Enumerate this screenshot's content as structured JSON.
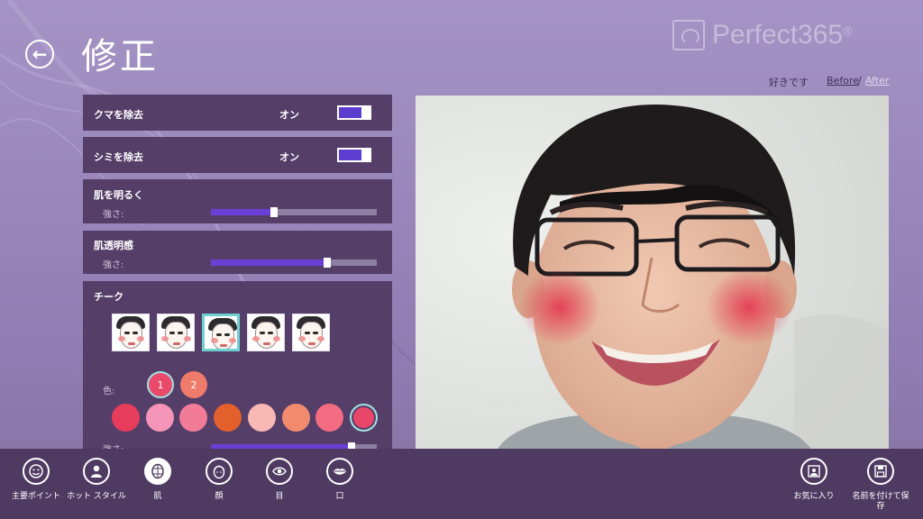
{
  "header": {
    "back_icon": "arrow-left-icon",
    "title": "修正",
    "logo_text": "Perfect365",
    "logo_mark": "®"
  },
  "view": {
    "favorite": "好きです",
    "before": "Before",
    "separator": "/",
    "after": "After"
  },
  "panels": {
    "dark_circles": {
      "label": "クマを除去",
      "state": "オン",
      "on": true
    },
    "spots": {
      "label": "シミを除去",
      "state": "オン",
      "on": true
    },
    "brighten": {
      "label": "肌を明るく",
      "strength_label": "強さ:",
      "value": 0.38
    },
    "clarity": {
      "label": "肌透明感",
      "strength_label": "強さ:",
      "value": 0.7
    },
    "cheek": {
      "label": "チーク",
      "styles": [
        "cheek-style-1",
        "cheek-style-2",
        "cheek-style-3",
        "cheek-style-4",
        "cheek-style-5"
      ],
      "selected_style": 2,
      "color_label": "色:",
      "color_slots": [
        {
          "label": "1",
          "color": "#ea4a6a",
          "selected": true
        },
        {
          "label": "2",
          "color": "#ef7b6b",
          "selected": false
        }
      ],
      "palette": [
        "#e83c5c",
        "#f596b8",
        "#f27c98",
        "#e3602c",
        "#f8b8b4",
        "#f28b6e",
        "#f46c82",
        "#e8476a"
      ],
      "selected_color": 7,
      "strength_label": "強さ:",
      "strength": 0.85
    }
  },
  "toolbar": {
    "items": [
      {
        "label": "主要ポイント",
        "icon": "smiley-icon"
      },
      {
        "label": "ホット スタイル",
        "icon": "person-icon"
      },
      {
        "label": "肌",
        "icon": "skin-icon",
        "active": true
      },
      {
        "label": "顔",
        "icon": "face-icon"
      },
      {
        "label": "目",
        "icon": "eye-icon"
      },
      {
        "label": "口",
        "icon": "lips-icon"
      }
    ],
    "favorites": {
      "label": "お気に入り",
      "icon": "favorites-icon"
    },
    "save_as": {
      "label": "名前を付けて保存",
      "label_line1": "名前を付けて保",
      "label_line2": "存",
      "icon": "save-icon"
    }
  },
  "colors": {
    "accent": "#6a3fd6",
    "panel": "#553e68",
    "bottom_bar": "#4f3a62",
    "selection": "#9fe3e3"
  }
}
